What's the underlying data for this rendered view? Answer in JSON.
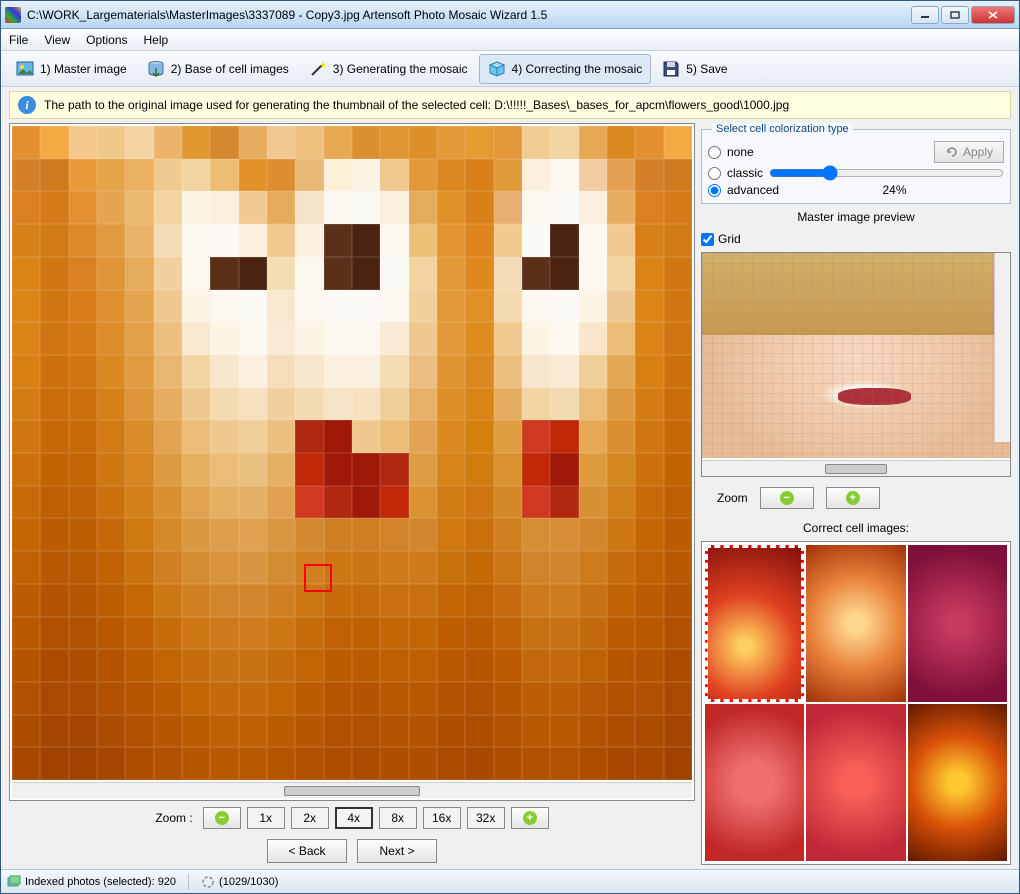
{
  "titlebar": {
    "text": "C:\\WORK_Largematerials\\MasterImages\\3337089 - Copy3.jpg Artensoft Photo Mosaic Wizard 1.5"
  },
  "menu": {
    "items": [
      "File",
      "View",
      "Options",
      "Help"
    ]
  },
  "toolbar": {
    "steps": [
      {
        "label": "1) Master image",
        "active": false
      },
      {
        "label": "2) Base of cell images",
        "active": false
      },
      {
        "label": "3) Generating the mosaic",
        "active": false
      },
      {
        "label": "4) Correcting the mosaic",
        "active": true
      },
      {
        "label": "5) Save",
        "active": false
      }
    ]
  },
  "infobar": {
    "text": "The path to the original image used for generating the thumbnail of the selected cell: D:\\!!!!!_Bases\\_bases_for_apcm\\flowers_good\\1000.jpg"
  },
  "colorization": {
    "group_title": "Select cell colorization type",
    "options": {
      "none": "none",
      "classic": "classic",
      "advanced": "advanced"
    },
    "selected": "advanced",
    "percent": "24%",
    "apply_label": "Apply"
  },
  "preview": {
    "title": "Master image preview",
    "grid_label": "Grid",
    "grid_checked": true,
    "zoom_label": "Zoom"
  },
  "main_zoom": {
    "label": "Zoom  :",
    "levels": [
      "1x",
      "2x",
      "4x",
      "8x",
      "16x",
      "32x"
    ],
    "selected": "4x"
  },
  "correct_cells": {
    "title": "Correct cell images:"
  },
  "nav": {
    "back": "< Back",
    "next": "Next >"
  },
  "status": {
    "indexed": "Indexed photos (selected): 920",
    "progress": "(1029/1030)"
  },
  "mosaic_cell_colors": [
    "#e28f30",
    "#f4a942",
    "#f4c98b",
    "#f0c888",
    "#f4d4a0",
    "#ecb46a",
    "#e29830",
    "#d68830",
    "#e6ad60",
    "#f0c890",
    "#edc07c",
    "#e6a850",
    "#da9030",
    "#e09630",
    "#de9028",
    "#e49838",
    "#e49c30",
    "#e2973a",
    "#f0cc94",
    "#f2d4a0",
    "#e6a852",
    "#da8820",
    "#d38028",
    "#d07a1e",
    "#e89a38",
    "#e6a448",
    "#eab060",
    "#f0cb90",
    "#f2d4a0",
    "#edbb74",
    "#e29028",
    "#de8c30",
    "#e8b874",
    "#fbf0d8",
    "#fcf4e4",
    "#f0c890",
    "#e09838",
    "#dc8820",
    "#da8018",
    "#e09a38",
    "#fbf0e0",
    "#fcf8f0",
    "#f0cca0",
    "#e4a050",
    "#da8020",
    "#d47a18",
    "#e29030",
    "#e6a350",
    "#eab870",
    "#f2d4a0",
    "#fcf4e4",
    "#fbf0e0",
    "#f0ca90",
    "#e6ab5a",
    "#f6e4c8",
    "#fcf8f0",
    "#fcfaf4",
    "#fbf0e0",
    "#e6ab5a",
    "#e09028",
    "#da8018",
    "#e8b070",
    "#fcf8f0",
    "#fcfaf4",
    "#fbf0e0",
    "#e8ac60",
    "#d88018",
    "#d27a14",
    "#de8828",
    "#e29a40",
    "#e8b46c",
    "#f4dcb8",
    "#fcf8f0",
    "#fcfaf4",
    "#fbf0e0",
    "#f0c890",
    "#fbf0e0",
    "#5a3018",
    "#4a2410",
    "#fcf8f0",
    "#edc078",
    "#e29430",
    "#de8520",
    "#f0ca90",
    "#fcfaf4",
    "#4a2410",
    "#fcf8f0",
    "#f0ca90",
    "#da8418",
    "#d07610",
    "#da8020",
    "#e09438",
    "#e6ab58",
    "#f0d0a0",
    "#fcf8f0",
    "#5a3018",
    "#4a2410",
    "#f4dcb4",
    "#fcf8f0",
    "#5a3018",
    "#4a2410",
    "#fcfaf4",
    "#f2d4a0",
    "#e29a38",
    "#de8820",
    "#f4dcb8",
    "#5a3018",
    "#4a2410",
    "#fcf8f0",
    "#f2d4a0",
    "#dc8518",
    "#d07610",
    "#d87c18",
    "#de9030",
    "#e4a550",
    "#eec890",
    "#fcf4e4",
    "#fcf8f0",
    "#fcfaf4",
    "#f8e8d0",
    "#fcf8f0",
    "#fcfaf4",
    "#fcfaf4",
    "#fcf8f0",
    "#f2d09c",
    "#e29a38",
    "#e09028",
    "#f4dab0",
    "#fcf8f0",
    "#fcfaf4",
    "#fcf4e4",
    "#eec894",
    "#da8418",
    "#ce7410",
    "#d47a14",
    "#dc8c28",
    "#e2a048",
    "#ecbf80",
    "#f8e8d0",
    "#fcf4e4",
    "#fcf8f0",
    "#f8ead4",
    "#fcf4e4",
    "#fcf8f0",
    "#fcf8f0",
    "#f8ead4",
    "#eec890",
    "#e29a38",
    "#de8c20",
    "#f0ca90",
    "#fcf4e4",
    "#fcf8f0",
    "#f8e6cc",
    "#eabc78",
    "#d88014",
    "#cc700c",
    "#d07610",
    "#da8820",
    "#e09a40",
    "#e8b670",
    "#f2d4a0",
    "#f8e6cc",
    "#fbf0e0",
    "#f4deba",
    "#f8e6cc",
    "#fbf0e0",
    "#fbf0e0",
    "#f4dcb4",
    "#eabd80",
    "#e09430",
    "#dc8820",
    "#eabf80",
    "#f8e6cc",
    "#f8ead4",
    "#f0ce98",
    "#e4a854",
    "#d47c14",
    "#ca6c0a",
    "#cc700c",
    "#d68018",
    "#de9438",
    "#e6ac60",
    "#eec890",
    "#f4dab0",
    "#f6e0c0",
    "#f0d0a0",
    "#f4dab0",
    "#f6e2c4",
    "#f6e0c0",
    "#f0ce98",
    "#e6b06a",
    "#de9028",
    "#da8418",
    "#e4ac60",
    "#f2d4a0",
    "#f4dab0",
    "#eabc78",
    "#de9a40",
    "#d07610",
    "#c66808",
    "#c86a08",
    "#d27a14",
    "#da8c28",
    "#e2a350",
    "#ebbb78",
    "#efc890",
    "#f0ce98",
    "#eabf80",
    "#b02810",
    "#a01808",
    "#efc890",
    "#eabc78",
    "#e2a454",
    "#da8820",
    "#d68010",
    "#e09c40",
    "#d03820",
    "#c02808",
    "#e4a952",
    "#da9030",
    "#cc700c",
    "#c26404",
    "#c46604",
    "#ce7610",
    "#d68520",
    "#de9a40",
    "#e4b060",
    "#eabc78",
    "#eac080",
    "#e4b064",
    "#c02808",
    "#a01808",
    "#a01808",
    "#b02810",
    "#de9c42",
    "#d68418",
    "#d27c10",
    "#da9230",
    "#c02808",
    "#a01808",
    "#de9b3e",
    "#d4861f",
    "#c86a08",
    "#be6002",
    "#c06204",
    "#ca700c",
    "#d28018",
    "#da9030",
    "#e0a350",
    "#e4b060",
    "#e4b066",
    "#e0a050",
    "#d03820",
    "#b02810",
    "#a01808",
    "#c02808",
    "#da9234",
    "#d27c14",
    "#ce7410",
    "#d48828",
    "#d03820",
    "#b02810",
    "#d89034",
    "#d07e1a",
    "#c46604",
    "#bc5c02",
    "#bc5e02",
    "#c66808",
    "#ce7810",
    "#d48a28",
    "#da9840",
    "#de9f4c",
    "#dea250",
    "#da9540",
    "#d48a30",
    "#d08024",
    "#cf7e22",
    "#d2832a",
    "#d4862c",
    "#ce780e",
    "#ca700a",
    "#d08020",
    "#d68e35",
    "#d78d36",
    "#d4862c",
    "#cc7614",
    "#c06204",
    "#b85802",
    "#b85a01",
    "#c26404",
    "#ca720c",
    "#d08020",
    "#d48c30",
    "#d8933c",
    "#d89440",
    "#d48c30",
    "#d08020",
    "#cc7614",
    "#cb7413",
    "#ce7a18",
    "#ce7a1a",
    "#c87009",
    "#c66a06",
    "#ca7614",
    "#d08328",
    "#d0842b",
    "#ce7b1d",
    "#c66c0c",
    "#bc5c02",
    "#b45400",
    "#b45600",
    "#be5e02",
    "#c46804",
    "#cc7614",
    "#d08020",
    "#d2862a",
    "#d2872c",
    "#d08020",
    "#cc7614",
    "#c66c0a",
    "#c56b09",
    "#c87010",
    "#c87010",
    "#c46605",
    "#c06204",
    "#c66c0e",
    "#cc7a1c",
    "#cc7b1e",
    "#c87214",
    "#c06406",
    "#b85801",
    "#b05000",
    "#b05200",
    "#b85800",
    "#c06002",
    "#c66c0a",
    "#cc7614",
    "#ce7a1c",
    "#ce7b1d",
    "#cc7614",
    "#c66c0a",
    "#c06202",
    "#bf6101",
    "#c26606",
    "#c26606",
    "#be5e01",
    "#bc5c00",
    "#c06406",
    "#c67012",
    "#c67014",
    "#c26a0c",
    "#bc5c02",
    "#b45400",
    "#ac4c00",
    "#ac4e00",
    "#b45400",
    "#bc5c01",
    "#c26604",
    "#c66c0c",
    "#c87212",
    "#c87213",
    "#c66c0c",
    "#c26604",
    "#bc5c01",
    "#bb5b00",
    "#be6002",
    "#be6002",
    "#ba5800",
    "#b85600",
    "#bc5c02",
    "#c2680c",
    "#c2680d",
    "#be6206",
    "#b85600",
    "#b05000",
    "#a84a00",
    "#a84a00",
    "#b05000",
    "#b65400",
    "#bc5c01",
    "#c26604",
    "#c46a0a",
    "#c46a0a",
    "#c26604",
    "#bc5c01",
    "#b65400",
    "#b55300",
    "#b85800",
    "#b85800",
    "#b45200",
    "#b25000",
    "#b65600",
    "#bc5e04",
    "#bc5e05",
    "#b85802",
    "#b25000",
    "#ac4c00",
    "#a44600",
    "#a44600",
    "#ac4c00",
    "#b25000",
    "#b85600",
    "#bc5c01",
    "#be6004",
    "#be6004",
    "#bc5c01",
    "#b85600",
    "#b25000",
    "#b14f00",
    "#b45200",
    "#b45200",
    "#b04e00",
    "#ae4c00",
    "#b25200",
    "#b85800",
    "#b85801",
    "#b45200",
    "#ae4c00",
    "#a84800",
    "#a04200",
    "#a04200",
    "#a64600",
    "#ae4c00",
    "#b25000",
    "#b85600",
    "#b85800",
    "#b85800",
    "#b65400",
    "#b25000",
    "#ae4c00",
    "#ad4b00",
    "#b04e00",
    "#b04e00",
    "#ac4a00",
    "#aa4800",
    "#ae4c00",
    "#b25000",
    "#b25100",
    "#ae4c00",
    "#a84800",
    "#a24200",
    "#9c3e00"
  ],
  "correct_cell_colors": [
    "#c0281a",
    "#e0783a",
    "#a0203a",
    "#c83030",
    "#d8404a",
    "#c04808"
  ]
}
